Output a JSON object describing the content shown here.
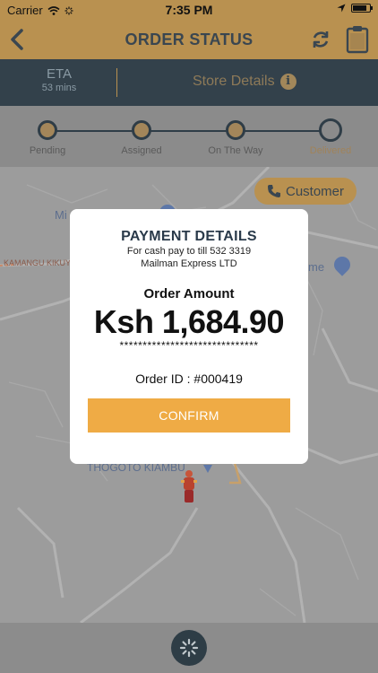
{
  "status_bar": {
    "carrier": "Carrier",
    "time": "7:35 PM"
  },
  "nav": {
    "title": "ORDER STATUS"
  },
  "info": {
    "eta_label": "ETA",
    "eta_value": "53 mins",
    "store_label": "Store Details",
    "info_glyph": "i"
  },
  "steps": [
    {
      "label": "Pending"
    },
    {
      "label": "Assigned"
    },
    {
      "label": "On The Way"
    },
    {
      "label": "Delivered"
    }
  ],
  "map": {
    "customer_label": "Customer",
    "labels": {
      "left_partial": "Mi",
      "road": "KAMANGU KIKUY",
      "right_partial": "me",
      "place": "THOGOTO KIAMBU"
    }
  },
  "modal": {
    "heading": "PAYMENT DETAILS",
    "line1": "For cash pay to till 532 3319",
    "line2": "Mailman Express LTD",
    "amount_label": "Order Amount",
    "amount": "Ksh 1,684.90",
    "masked": "******************************",
    "order_id": "Order ID : #000419",
    "confirm_label": "CONFIRM"
  },
  "colors": {
    "accent": "#b99150",
    "dark": "#33414b",
    "confirm": "#efab45"
  },
  "icons": [
    "wifi-icon",
    "activity-icon",
    "location-arrow-icon",
    "battery-icon",
    "back-chevron-icon",
    "refresh-icon",
    "clipboard-icon",
    "info-icon",
    "phone-icon",
    "spinner-icon"
  ]
}
